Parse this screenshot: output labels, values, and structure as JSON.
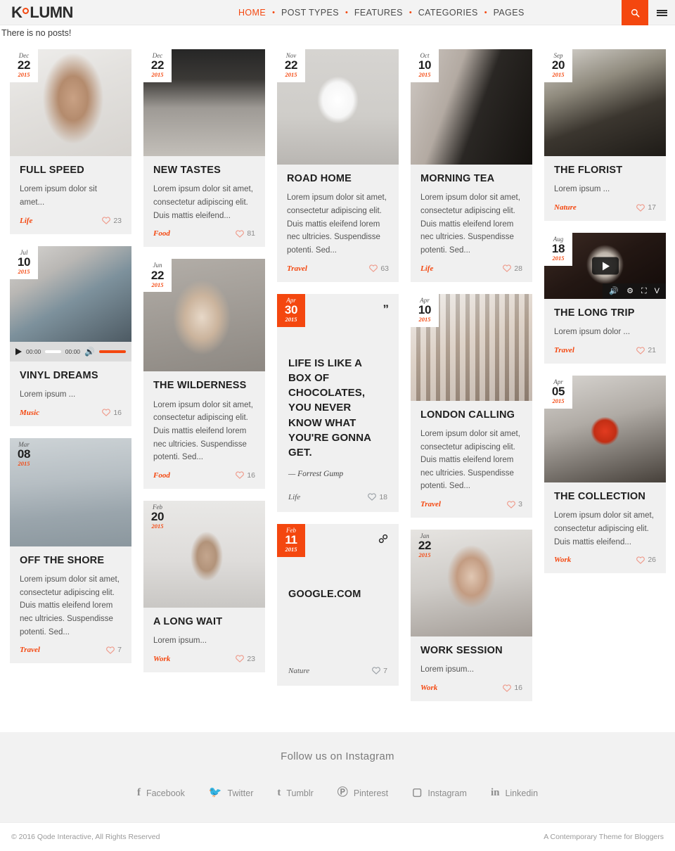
{
  "header": {
    "logo": {
      "pre": "K",
      "post": "LUMN",
      "dot_icon": "circle-dot"
    },
    "nav": [
      {
        "label": "HOME",
        "active": true
      },
      {
        "label": "POST TYPES",
        "active": false
      },
      {
        "label": "FEATURES",
        "active": false
      },
      {
        "label": "CATEGORIES",
        "active": false
      },
      {
        "label": "PAGES",
        "active": false
      }
    ],
    "separator": "•",
    "search_icon": "search-icon",
    "menu_icon": "hamburger-icon",
    "accent_color": "#f4470f",
    "bg_color": "#f3f3f3"
  },
  "notice": {
    "text": "There is no posts!"
  },
  "cards": {
    "full_speed": {
      "month": "Dec",
      "day": "22",
      "year": "2015",
      "title": "FULL SPEED",
      "excerpt": "Lorem ipsum dolor sit amet...",
      "category": "Life",
      "likes": "23"
    },
    "vinyl_dreams": {
      "month": "Jul",
      "day": "10",
      "year": "2015",
      "title": "VINYL DREAMS",
      "excerpt": "Lorem ipsum ...",
      "category": "Music",
      "likes": "16",
      "audio": {
        "elapsed": "00:00",
        "duration": "00:00",
        "play_icon": "play-icon",
        "volume_icon": "volume-icon"
      }
    },
    "off_the_shore": {
      "month": "Mar",
      "day": "08",
      "year": "2015",
      "title": "OFF THE SHORE",
      "excerpt": "Lorem ipsum dolor sit amet, consectetur adipiscing elit. Duis mattis eleifend lorem nec ultricies. Suspendisse potenti. Sed...",
      "category": "Travel",
      "likes": "7"
    },
    "new_tastes": {
      "month": "Dec",
      "day": "22",
      "year": "2015",
      "title": "NEW TASTES",
      "excerpt": "Lorem ipsum dolor sit amet, consectetur adipiscing elit. Duis mattis eleifend...",
      "category": "Food",
      "likes": "81"
    },
    "the_wilderness": {
      "month": "Jun",
      "day": "22",
      "year": "2015",
      "title": "THE WILDERNESS",
      "excerpt": "Lorem ipsum dolor sit amet, consectetur adipiscing elit. Duis mattis eleifend lorem nec ultricies. Suspendisse potenti. Sed...",
      "category": "Food",
      "likes": "16"
    },
    "a_long_wait": {
      "month": "Feb",
      "day": "20",
      "year": "2015",
      "title": "A LONG WAIT",
      "excerpt": "Lorem ipsum...",
      "category": "Work",
      "likes": "23"
    },
    "road_home": {
      "month": "Nov",
      "day": "22",
      "year": "2015",
      "title": "ROAD HOME",
      "excerpt": "Lorem ipsum dolor sit amet, consectetur adipiscing elit. Duis mattis eleifend lorem nec ultricies. Suspendisse potenti. Sed...",
      "category": "Travel",
      "likes": "63"
    },
    "quote": {
      "month": "Apr",
      "day": "30",
      "year": "2015",
      "icon": "quote-icon",
      "text": "LIFE IS LIKE A BOX OF CHOCOLATES, YOU NEVER KNOW WHAT YOU'RE GONNA GET.",
      "author": "— Forrest Gump",
      "category": "Life",
      "likes": "18"
    },
    "link": {
      "month": "Feb",
      "day": "11",
      "year": "2015",
      "icon": "link-icon",
      "title": "GOOGLE.COM",
      "category": "Nature",
      "likes": "7"
    },
    "morning_tea": {
      "month": "Oct",
      "day": "10",
      "year": "2015",
      "title": "MORNING TEA",
      "excerpt": "Lorem ipsum dolor sit amet, consectetur adipiscing elit. Duis mattis eleifend lorem nec ultricies. Suspendisse potenti. Sed...",
      "category": "Life",
      "likes": "28"
    },
    "london_calling": {
      "month": "Apr",
      "day": "10",
      "year": "2015",
      "title": "LONDON CALLING",
      "excerpt": "Lorem ipsum dolor sit amet, consectetur adipiscing elit. Duis mattis eleifend lorem nec ultricies. Suspendisse potenti. Sed...",
      "category": "Travel",
      "likes": "3"
    },
    "work_session": {
      "month": "Jan",
      "day": "22",
      "year": "2015",
      "title": "WORK SESSION",
      "excerpt": "Lorem ipsum...",
      "category": "Work",
      "likes": "16"
    },
    "the_florist": {
      "month": "Sep",
      "day": "20",
      "year": "2015",
      "title": "THE FLORIST",
      "excerpt": "Lorem ipsum ...",
      "category": "Nature",
      "likes": "17"
    },
    "the_long_trip": {
      "month": "Aug",
      "day": "18",
      "year": "2015",
      "title": "THE LONG TRIP",
      "excerpt": "Lorem ipsum dolor ...",
      "category": "Travel",
      "likes": "21",
      "video": {
        "play_icon": "play-icon",
        "volume_icon": "volume-icon",
        "settings_icon": "gear-icon",
        "fullscreen_icon": "fullscreen-icon",
        "vimeo_icon": "vimeo-icon"
      }
    },
    "the_collection": {
      "month": "Apr",
      "day": "05",
      "year": "2015",
      "title": "THE COLLECTION",
      "excerpt": "Lorem ipsum dolor sit amet, consectetur adipiscing elit. Duis mattis eleifend...",
      "category": "Work",
      "likes": "26"
    }
  },
  "footer": {
    "instagram_title": "Follow us on Instagram",
    "socials": [
      {
        "label": "Facebook",
        "glyph": "f",
        "icon": "facebook-icon"
      },
      {
        "label": "Twitter",
        "glyph": "🐦",
        "icon": "twitter-icon"
      },
      {
        "label": "Tumblr",
        "glyph": "t",
        "icon": "tumblr-icon"
      },
      {
        "label": "Pinterest",
        "glyph": "Ⓟ",
        "icon": "pinterest-icon"
      },
      {
        "label": "Instagram",
        "glyph": "▢",
        "icon": "instagram-icon"
      },
      {
        "label": "Linkedin",
        "glyph": "in",
        "icon": "linkedin-icon"
      }
    ],
    "copyright": "© 2016 Qode Interactive, All Rights Reserved",
    "tagline": "A Contemporary Theme for Bloggers"
  }
}
